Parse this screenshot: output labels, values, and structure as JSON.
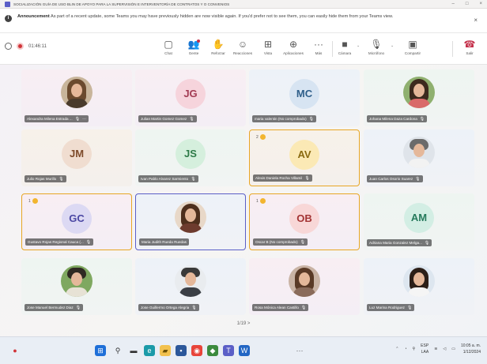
{
  "window": {
    "title": "SOCIALIZACIÓN GUÍA DE USO BLIN DE APOYO PARA LA SUPERVISIÓN E INTERVENTORÍA DE CONTRATOS Y O CONVENIOS"
  },
  "announcement": {
    "bold": "Announcement",
    "text": "As part of a recent update, some Teams you may have previously hidden are now visible again. If you'd prefer not to see them, you can easily hide them from your Teams view.",
    "close": "×"
  },
  "toolbar": {
    "timer": "01:46:11",
    "buttons": [
      {
        "label": "Chat",
        "icon": "chat-icon"
      },
      {
        "label": "Gente",
        "icon": "people-icon"
      },
      {
        "label": "Reforzar",
        "icon": "raise-hand-icon"
      },
      {
        "label": "Reacciones",
        "icon": "reactions-icon"
      },
      {
        "label": "Vista",
        "icon": "view-icon"
      },
      {
        "label": "Aplicaciones",
        "icon": "apps-icon"
      },
      {
        "label": "Más",
        "icon": "more-icon"
      },
      {
        "label": "Cámara",
        "icon": "camera-icon"
      },
      {
        "label": "Micrófono",
        "icon": "microphone-icon"
      },
      {
        "label": "Compartir",
        "icon": "share-icon"
      },
      {
        "label": "Salir",
        "icon": "leave-icon"
      }
    ]
  },
  "participants": [
    {
      "name": "Alexandra Milena Estrada ...",
      "type": "photo",
      "color": "pink"
    },
    {
      "name": "Julian Martin Gomez Gomez",
      "initials": "JG",
      "type": "initials",
      "color": "pink",
      "avatar_bg": "#f6d4dc",
      "avatar_fg": "#a23b53"
    },
    {
      "name": "maria valentin (No comprobado)",
      "initials": "MC",
      "type": "initials",
      "color": "blue",
      "avatar_bg": "#d7e4f2",
      "avatar_fg": "#2f5f8a"
    },
    {
      "name": "Johana Milena Daza Cardona",
      "type": "photo",
      "color": "green"
    },
    {
      "name": "Julio Rojas Murillo",
      "initials": "JM",
      "type": "initials",
      "color": "tan",
      "avatar_bg": "#f0ddd0",
      "avatar_fg": "#7d4a2a"
    },
    {
      "name": "Ivan Pablo Alvarez Sarmiento",
      "initials": "JS",
      "type": "initials",
      "color": "green",
      "avatar_bg": "#d5efdd",
      "avatar_fg": "#2d7a47"
    },
    {
      "name": "Alexis Daniela Rocha Villamil",
      "initials": "AV",
      "type": "initials",
      "color": "tan",
      "avatar_bg": "#fbe9b5",
      "avatar_fg": "#8a6a10",
      "hand": "2",
      "highlight": true
    },
    {
      "name": "Juan Carlos Osorio Suarez",
      "type": "photo",
      "color": "blue"
    },
    {
      "name": "Gustavo Rojas Regional Cauca (...",
      "initials": "GC",
      "type": "initials",
      "color": "pink",
      "avatar_bg": "#dcd9f3",
      "avatar_fg": "#4a47a3",
      "hand": "1",
      "highlight": true
    },
    {
      "name": "Maria Judith Rueda Ruedas",
      "type": "photo",
      "color": "blue",
      "active": true
    },
    {
      "name": "Oscar B (No comprobado)",
      "initials": "OB",
      "type": "initials",
      "color": "pink",
      "avatar_bg": "#f8d7d7",
      "avatar_fg": "#a33434",
      "hand": "1",
      "highlight": true
    },
    {
      "name": "Adriana Maria Gonzalez Melga...",
      "initials": "AM",
      "type": "initials",
      "color": "green",
      "avatar_bg": "#d3eee4",
      "avatar_fg": "#267a5c"
    },
    {
      "name": "Jose Manuel Bermudez Diaz",
      "type": "photo",
      "color": "green"
    },
    {
      "name": "Jose Guillermo Ortega Alegria",
      "type": "photo",
      "color": "blue"
    },
    {
      "name": "Rosa Mónica Alean Castillo",
      "type": "photo",
      "color": "pink"
    },
    {
      "name": "Luz Marina Rodriguez",
      "type": "photo",
      "color": "blue"
    }
  ],
  "pager": "1/19 >",
  "taskbar": {
    "lang_top": "ESP",
    "lang_bottom": "LAA",
    "time": "10:05 a. m.",
    "date": "1/12/2024"
  }
}
